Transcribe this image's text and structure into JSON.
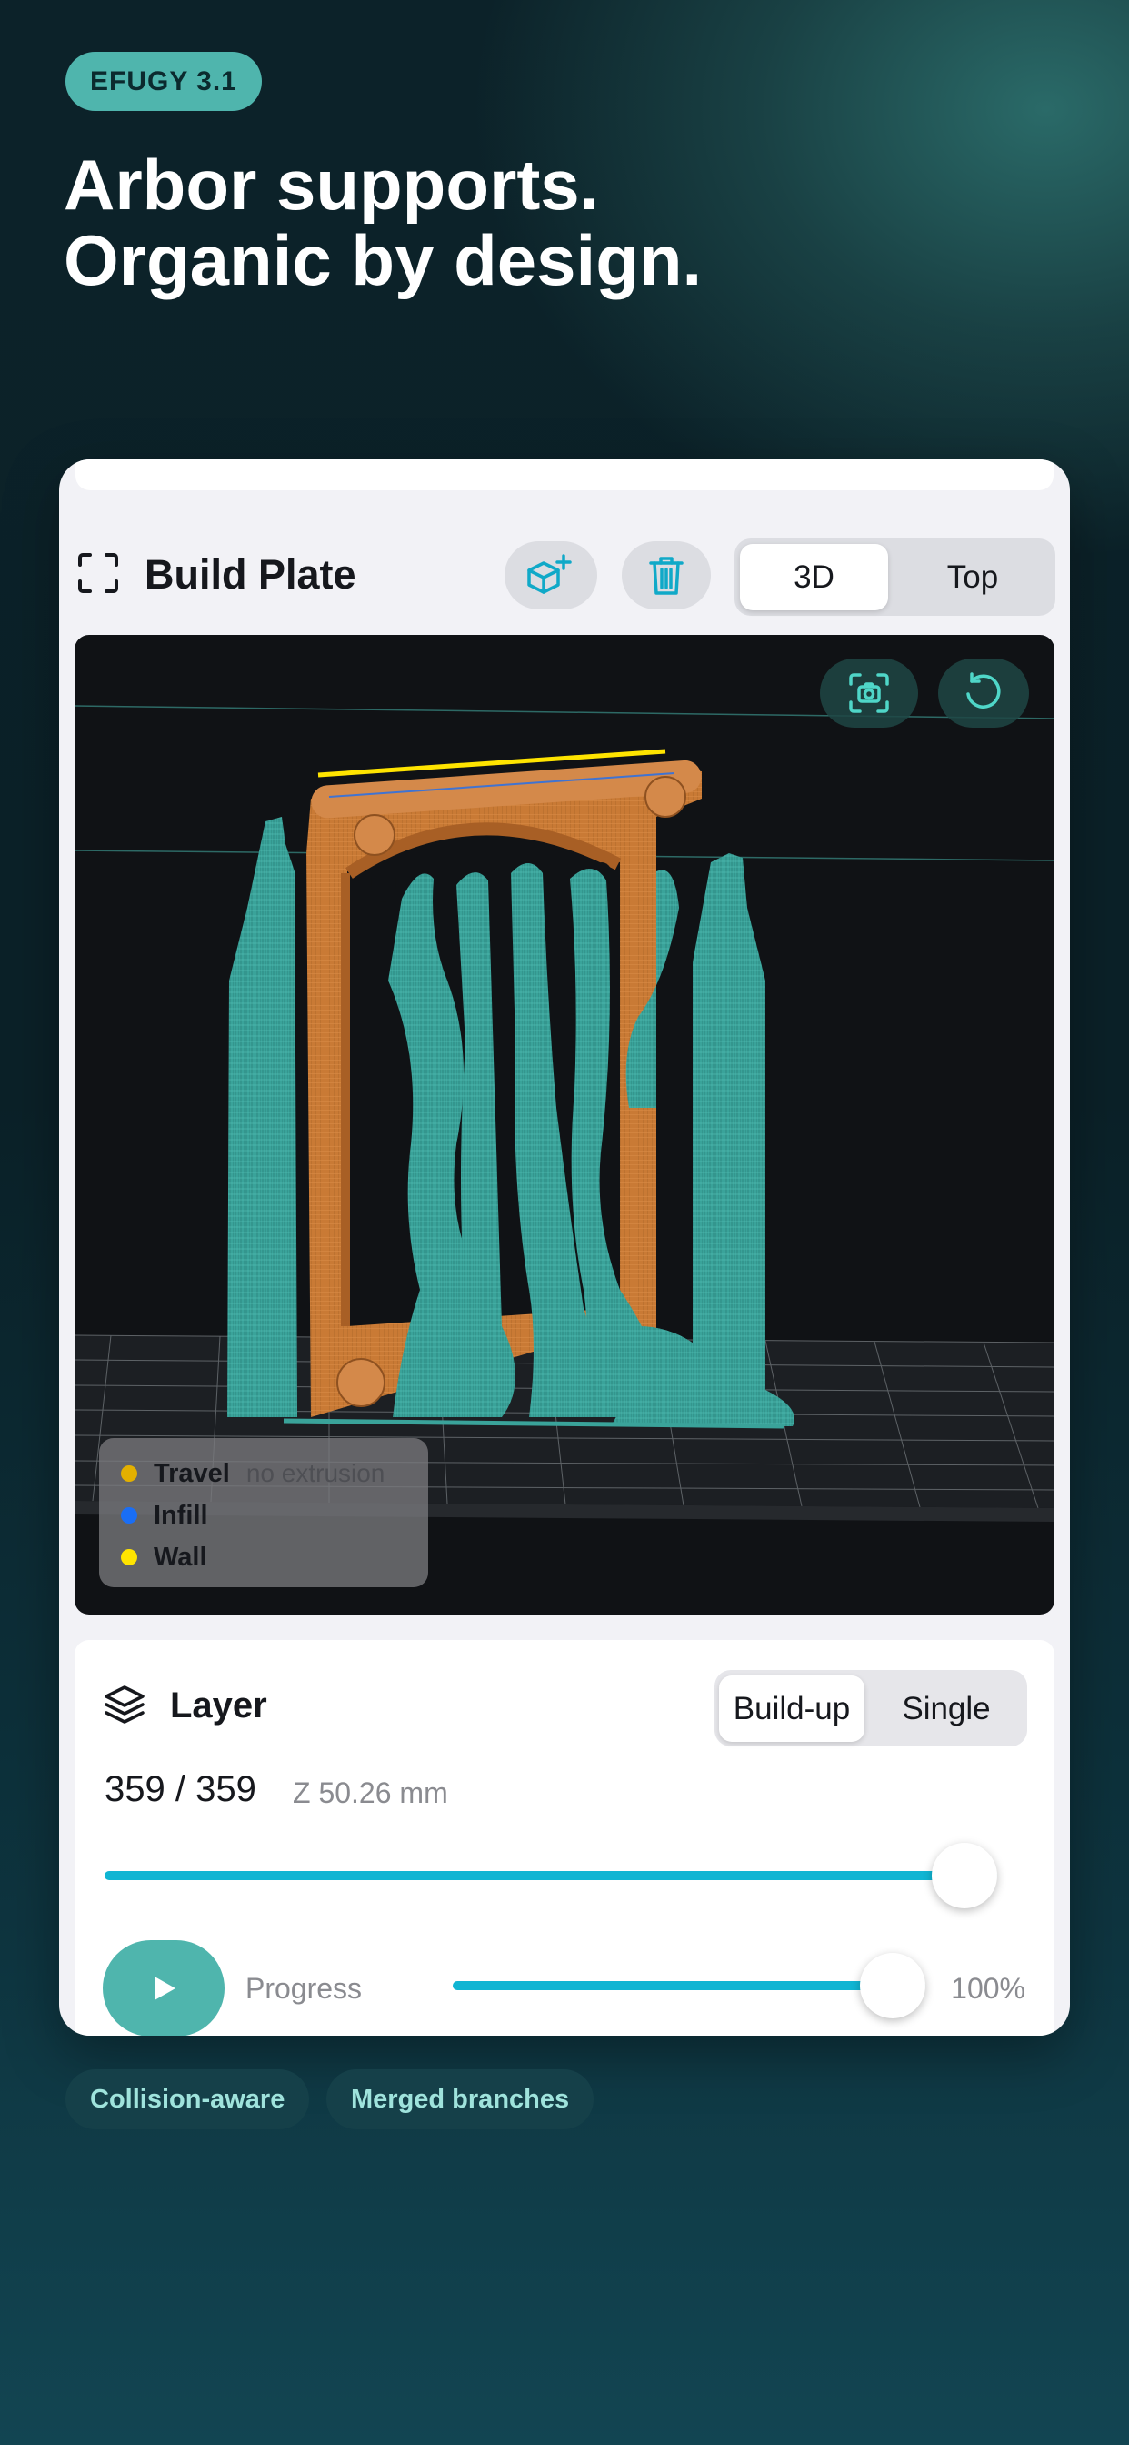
{
  "badge": "EFUGY 3.1",
  "headline": [
    "Arbor supports.",
    "Organic by design."
  ],
  "plate": {
    "title": "Build Plate",
    "view_options": [
      "3D",
      "Top"
    ],
    "active_view": "3D",
    "add_icon": "add-object-icon",
    "delete_icon": "trash-icon"
  },
  "viewport": {
    "legend": [
      {
        "label": "Travel",
        "note": "no extrusion",
        "color": "#e3b000"
      },
      {
        "label": "Infill",
        "note": "",
        "color": "#1a6ef5"
      },
      {
        "label": "Wall",
        "note": "",
        "color": "#ffe400"
      }
    ]
  },
  "layer": {
    "title": "Layer",
    "modes": [
      "Build-up",
      "Single"
    ],
    "active_mode": "Build-up",
    "count": "359 / 359",
    "z": "Z 50.26 mm",
    "layer_fraction": 1.0,
    "progress_label": "Progress",
    "progress_value": "100%",
    "progress_fraction": 1.0
  },
  "tags": [
    "Collision-aware",
    "Merged branches"
  ],
  "colors": {
    "accent": "#4fb5ad",
    "slider": "#10b5d3",
    "support": "#3aa39a",
    "model": "#c97a35"
  }
}
